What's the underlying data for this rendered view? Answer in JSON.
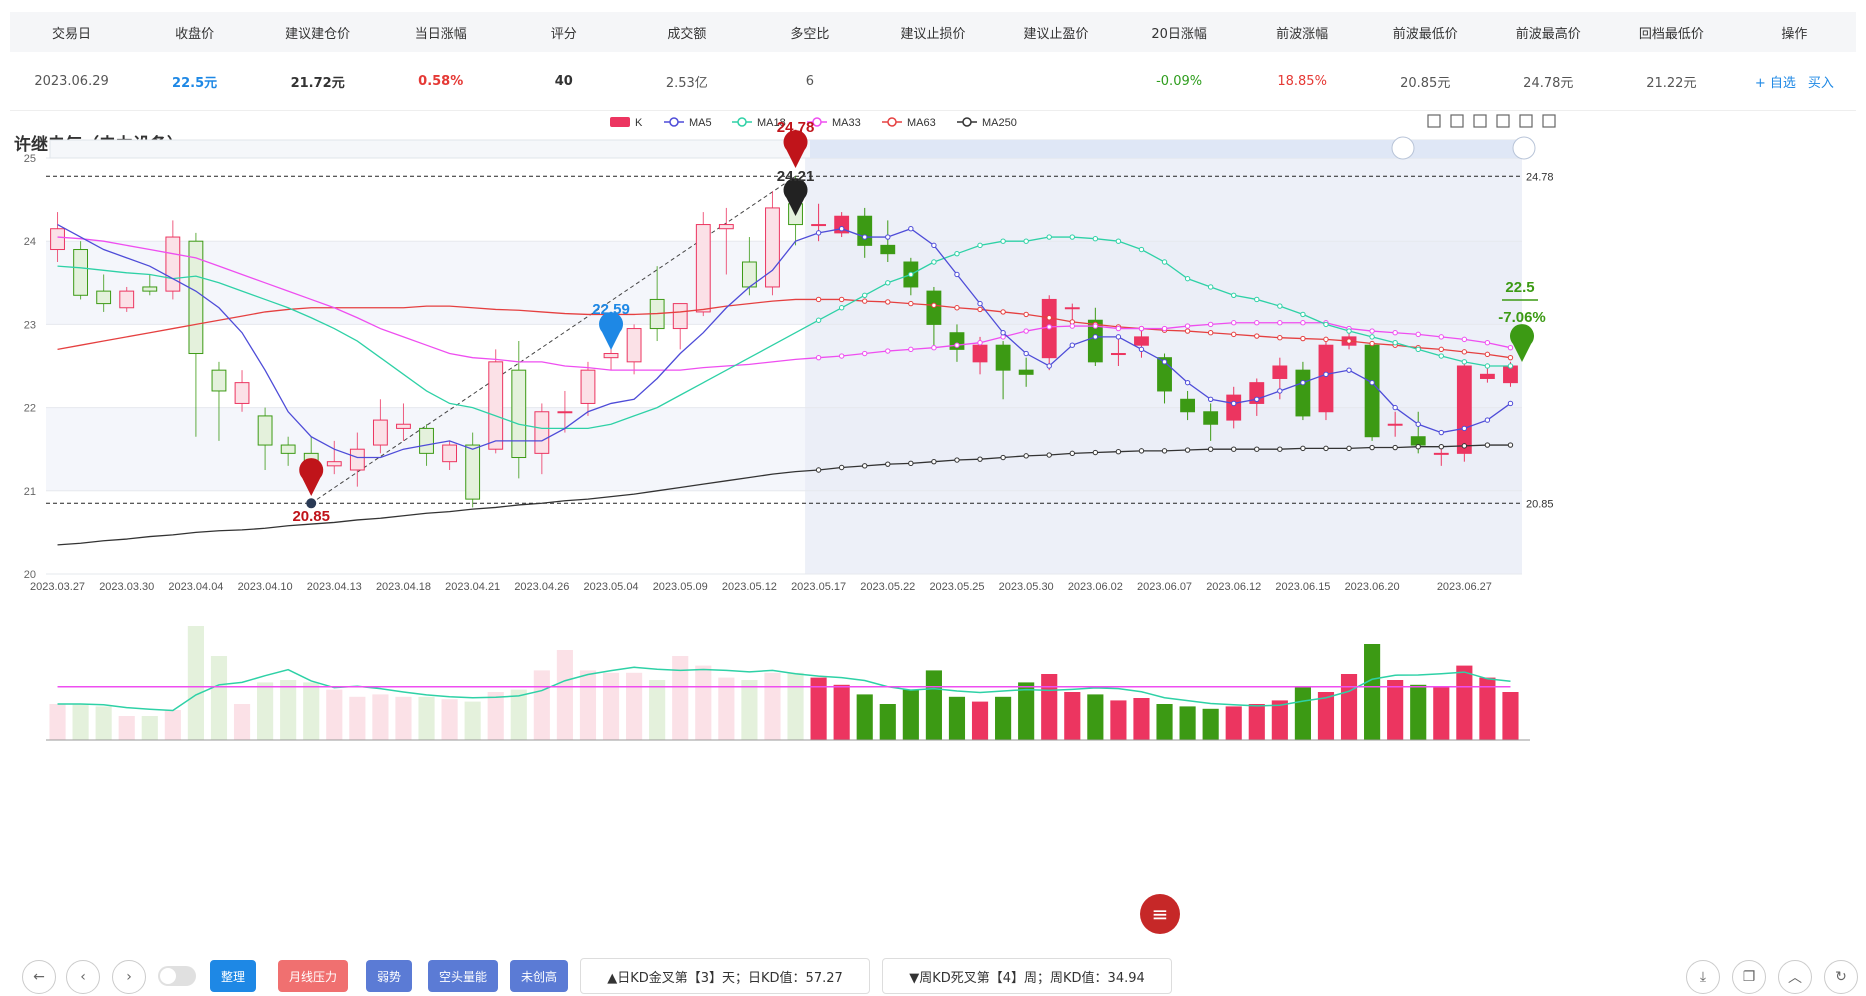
{
  "table": {
    "headers": [
      "交易日",
      "收盘价",
      "建议建仓价",
      "当日涨幅",
      "评分",
      "成交额",
      "多空比",
      "建议止损价",
      "建议止盈价",
      "20日涨幅",
      "前波涨幅",
      "前波最低价",
      "前波最高价",
      "回档最低价",
      "操作"
    ],
    "row": [
      "2023.06.29",
      "22.5元",
      "21.72元",
      "0.58%",
      "40",
      "2.53亿",
      "6",
      "",
      "",
      "-0.09%",
      "18.85%",
      "20.85元",
      "24.78元",
      "21.22元",
      ""
    ],
    "actions": {
      "watch": "+ 自选",
      "buy": "买入"
    }
  },
  "title": "许继电气（电力设备）",
  "legend": [
    "K",
    "MA5",
    "MA18",
    "MA33",
    "MA63",
    "MA250"
  ],
  "colors": {
    "up": "#ec3560",
    "down": "#3c9a14",
    "ma5": "#4e4cd8",
    "ma18": "#2ed1a6",
    "ma33": "#ee4ef0",
    "ma63": "#e54040",
    "ma250": "#333333"
  },
  "markers": {
    "high": {
      "label": "24.78",
      "value": 24.78,
      "date": "2023.05.16"
    },
    "second": {
      "label": "24.21",
      "value": 24.21,
      "date": "2023.05.16"
    },
    "low": {
      "label": "20.85",
      "value": 20.85,
      "date": "2023.04.12"
    },
    "mid": {
      "label": "22.59",
      "value": 22.59,
      "date": "2023.05.04"
    },
    "last": {
      "label": "22.5",
      "pct": "-7.06%",
      "value": 22.5,
      "date": "2023.06.29"
    }
  },
  "refLines": {
    "top": "24.78",
    "bottom": "20.85"
  },
  "chart_data": {
    "type": "candlestick",
    "ylim": [
      20,
      25
    ],
    "yticks": [
      20,
      21,
      22,
      23,
      24,
      25
    ],
    "xtick_labels": [
      "2023.03.27",
      "2023.03.30",
      "2023.04.04",
      "2023.04.10",
      "2023.04.13",
      "2023.04.18",
      "2023.04.21",
      "2023.04.26",
      "2023.05.04",
      "2023.05.09",
      "2023.05.12",
      "2023.05.17",
      "2023.05.22",
      "2023.05.25",
      "2023.05.30",
      "2023.06.02",
      "2023.06.07",
      "2023.06.12",
      "2023.06.15",
      "2023.06.20",
      "2023.06.27"
    ],
    "candles": [
      [
        23.9,
        24.15,
        23.75,
        24.35
      ],
      [
        23.9,
        23.35,
        23.3,
        24.0
      ],
      [
        23.4,
        23.25,
        23.15,
        23.6
      ],
      [
        23.2,
        23.4,
        23.15,
        23.45
      ],
      [
        23.45,
        23.4,
        23.35,
        23.6
      ],
      [
        23.4,
        24.05,
        23.3,
        24.25
      ],
      [
        24.0,
        22.65,
        21.65,
        24.1
      ],
      [
        22.45,
        22.2,
        21.6,
        22.55
      ],
      [
        22.05,
        22.3,
        21.95,
        22.45
      ],
      [
        21.9,
        21.55,
        21.25,
        22.0
      ],
      [
        21.55,
        21.45,
        21.3,
        21.65
      ],
      [
        21.45,
        21.3,
        21.0,
        21.65
      ],
      [
        21.3,
        21.35,
        21.2,
        21.6
      ],
      [
        21.25,
        21.5,
        21.05,
        21.7
      ],
      [
        21.55,
        21.85,
        21.45,
        22.1
      ],
      [
        21.75,
        21.8,
        21.6,
        22.05
      ],
      [
        21.75,
        21.45,
        21.3,
        21.8
      ],
      [
        21.35,
        21.55,
        21.25,
        21.6
      ],
      [
        21.55,
        20.9,
        20.8,
        21.7
      ],
      [
        21.5,
        22.55,
        21.45,
        22.7
      ],
      [
        22.45,
        21.4,
        21.15,
        22.8
      ],
      [
        21.45,
        21.95,
        21.2,
        22.05
      ],
      [
        21.95,
        21.95,
        21.7,
        22.2
      ],
      [
        22.05,
        22.45,
        21.9,
        22.55
      ],
      [
        22.6,
        22.65,
        22.45,
        22.8
      ],
      [
        22.55,
        22.95,
        22.4,
        23.0
      ],
      [
        23.3,
        22.95,
        22.8,
        23.7
      ],
      [
        22.95,
        23.25,
        22.7,
        23.25
      ],
      [
        23.15,
        24.2,
        23.1,
        24.35
      ],
      [
        24.15,
        24.2,
        23.6,
        24.4
      ],
      [
        23.75,
        23.45,
        23.35,
        24.05
      ],
      [
        23.45,
        24.4,
        23.35,
        24.6
      ],
      [
        24.45,
        24.2,
        23.95,
        24.78
      ],
      [
        24.2,
        24.2,
        24.0,
        24.45
      ],
      [
        24.1,
        24.3,
        24.05,
        24.35
      ],
      [
        24.3,
        23.95,
        23.8,
        24.4
      ],
      [
        23.95,
        23.85,
        23.75,
        24.25
      ],
      [
        23.75,
        23.45,
        23.35,
        23.8
      ],
      [
        23.4,
        23.0,
        22.75,
        23.45
      ],
      [
        22.9,
        22.7,
        22.55,
        23.0
      ],
      [
        22.55,
        22.75,
        22.4,
        22.85
      ],
      [
        22.75,
        22.45,
        22.1,
        22.8
      ],
      [
        22.45,
        22.4,
        22.25,
        22.6
      ],
      [
        22.6,
        23.3,
        22.45,
        23.35
      ],
      [
        23.2,
        23.2,
        23.0,
        23.25
      ],
      [
        23.05,
        22.55,
        22.5,
        23.2
      ],
      [
        22.65,
        22.65,
        22.5,
        22.85
      ],
      [
        22.75,
        22.85,
        22.6,
        22.95
      ],
      [
        22.6,
        22.2,
        22.05,
        22.65
      ],
      [
        22.1,
        21.95,
        21.85,
        22.2
      ],
      [
        21.95,
        21.8,
        21.6,
        22.05
      ],
      [
        21.85,
        22.15,
        21.75,
        22.25
      ],
      [
        22.05,
        22.3,
        21.9,
        22.35
      ],
      [
        22.35,
        22.5,
        22.1,
        22.6
      ],
      [
        22.45,
        21.9,
        21.85,
        22.55
      ],
      [
        21.95,
        22.75,
        21.85,
        22.85
      ],
      [
        22.75,
        22.85,
        22.7,
        22.9
      ],
      [
        22.75,
        21.65,
        21.6,
        22.8
      ],
      [
        21.8,
        21.8,
        21.65,
        21.95
      ],
      [
        21.65,
        21.55,
        21.45,
        21.95
      ],
      [
        21.45,
        21.45,
        21.3,
        21.55
      ],
      [
        21.45,
        22.5,
        21.35,
        22.55
      ],
      [
        22.35,
        22.4,
        22.3,
        22.5
      ],
      [
        22.3,
        22.5,
        22.25,
        22.55
      ]
    ],
    "ma5": [
      24.2,
      24.05,
      23.9,
      23.8,
      23.7,
      23.55,
      23.4,
      23.2,
      22.9,
      22.45,
      21.95,
      21.65,
      21.5,
      21.4,
      21.4,
      21.5,
      21.55,
      21.6,
      21.5,
      21.6,
      21.6,
      21.6,
      21.75,
      21.95,
      22.05,
      22.1,
      22.35,
      22.65,
      22.9,
      23.2,
      23.45,
      23.65,
      24.0,
      24.1,
      24.15,
      24.05,
      24.05,
      24.15,
      23.95,
      23.6,
      23.25,
      22.9,
      22.65,
      22.5,
      22.75,
      22.85,
      22.85,
      22.7,
      22.55,
      22.3,
      22.1,
      22.05,
      22.1,
      22.2,
      22.3,
      22.4,
      22.45,
      22.3,
      22.0,
      21.8,
      21.7,
      21.75,
      21.85,
      22.05
    ],
    "ma18": [
      23.7,
      23.68,
      23.65,
      23.62,
      23.6,
      23.55,
      23.58,
      23.5,
      23.4,
      23.3,
      23.2,
      23.08,
      22.95,
      22.8,
      22.6,
      22.4,
      22.2,
      22.05,
      22.0,
      21.9,
      21.8,
      21.75,
      21.75,
      21.75,
      21.8,
      21.9,
      22.0,
      22.15,
      22.3,
      22.45,
      22.6,
      22.75,
      22.9,
      23.05,
      23.2,
      23.35,
      23.5,
      23.6,
      23.75,
      23.85,
      23.95,
      24.0,
      24.0,
      24.05,
      24.05,
      24.03,
      24.0,
      23.9,
      23.75,
      23.55,
      23.45,
      23.35,
      23.3,
      23.22,
      23.12,
      23.0,
      22.92,
      22.85,
      22.78,
      22.7,
      22.62,
      22.55,
      22.5,
      22.5
    ],
    "ma33": [
      24.05,
      24.03,
      24.0,
      23.95,
      23.9,
      23.85,
      23.8,
      23.7,
      23.6,
      23.5,
      23.4,
      23.3,
      23.2,
      23.08,
      22.95,
      22.85,
      22.75,
      22.65,
      22.6,
      22.58,
      22.55,
      22.55,
      22.5,
      22.48,
      22.45,
      22.45,
      22.45,
      22.45,
      22.48,
      22.5,
      22.52,
      22.55,
      22.58,
      22.6,
      22.62,
      22.65,
      22.68,
      22.7,
      22.72,
      22.75,
      22.78,
      22.85,
      22.92,
      22.97,
      22.98,
      22.98,
      22.95,
      22.95,
      22.95,
      22.98,
      23.0,
      23.02,
      23.02,
      23.02,
      23.02,
      23.02,
      22.95,
      22.92,
      22.9,
      22.88,
      22.85,
      22.82,
      22.78,
      22.72
    ],
    "ma63": [
      22.7,
      22.75,
      22.8,
      22.85,
      22.9,
      22.95,
      23.0,
      23.05,
      23.1,
      23.15,
      23.18,
      23.2,
      23.2,
      23.2,
      23.2,
      23.2,
      23.22,
      23.22,
      23.2,
      23.18,
      23.17,
      23.15,
      23.13,
      23.12,
      23.12,
      23.12,
      23.13,
      23.15,
      23.18,
      23.22,
      23.25,
      23.28,
      23.3,
      23.3,
      23.3,
      23.28,
      23.27,
      23.25,
      23.23,
      23.2,
      23.18,
      23.15,
      23.12,
      23.08,
      23.03,
      23.0,
      22.97,
      22.95,
      22.93,
      22.92,
      22.9,
      22.88,
      22.86,
      22.84,
      22.83,
      22.82,
      22.8,
      22.77,
      22.75,
      22.72,
      22.7,
      22.67,
      22.64,
      22.6
    ],
    "ma250": [
      20.35,
      20.37,
      20.4,
      20.42,
      20.45,
      20.47,
      20.5,
      20.52,
      20.53,
      20.55,
      20.58,
      20.6,
      20.62,
      20.65,
      20.67,
      20.7,
      20.73,
      20.75,
      20.78,
      20.8,
      20.83,
      20.85,
      20.88,
      20.9,
      20.93,
      20.96,
      21.0,
      21.04,
      21.08,
      21.12,
      21.16,
      21.2,
      21.23,
      21.25,
      21.28,
      21.3,
      21.32,
      21.33,
      21.35,
      21.37,
      21.38,
      21.4,
      21.42,
      21.43,
      21.45,
      21.46,
      21.47,
      21.48,
      21.48,
      21.49,
      21.5,
      21.5,
      21.5,
      21.5,
      21.51,
      21.51,
      21.51,
      21.52,
      21.52,
      21.53,
      21.53,
      21.54,
      21.55,
      21.55
    ],
    "volume": [
      30,
      30,
      28,
      20,
      20,
      25,
      95,
      70,
      30,
      48,
      50,
      48,
      42,
      36,
      38,
      36,
      36,
      34,
      32,
      40,
      42,
      58,
      75,
      58,
      56,
      56,
      50,
      70,
      62,
      52,
      50,
      56,
      56,
      52,
      46,
      38,
      30,
      42,
      58,
      36,
      32,
      36,
      48,
      55,
      40,
      38,
      33,
      35,
      30,
      28,
      26,
      28,
      30,
      33,
      45,
      40,
      55,
      80,
      50,
      46,
      45,
      62,
      52,
      40
    ]
  },
  "buttons": {
    "tidy": "整理",
    "monthly": "月线压力",
    "weak": "弱势",
    "shortp": "空头量能",
    "nonewhigh": "未创高"
  },
  "info": {
    "daily": "▲日KD金叉第【3】天；日KD值：57.27",
    "weekly": "▼周KD死叉第【4】周；周KD值：34.94"
  }
}
